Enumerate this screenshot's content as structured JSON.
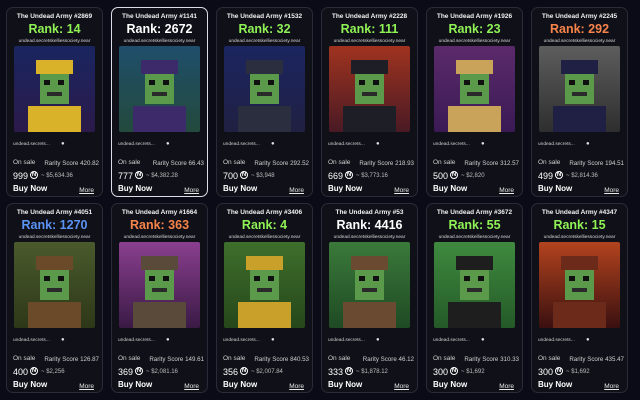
{
  "collection": "undead.secretskelliessociety.near",
  "owner_short": "undead.secrets...",
  "labels": {
    "on_sale": "On sale",
    "buy_now": "Buy Now",
    "more": "More",
    "near_symbol": "N"
  },
  "colors": {
    "green": "#8ff255",
    "white": "#ffffff",
    "orange": "#f7844a",
    "blue": "#5b93f5"
  },
  "cards": [
    {
      "title": "The Undead Army #2869",
      "rank": "Rank: 14",
      "rank_color": "green",
      "rarity": "Rarity Score 420.82",
      "price": "999",
      "usd": "~ $5,634.36",
      "bg": [
        "#1a2560",
        "#2b1a4a"
      ],
      "accent": "#d9b22a"
    },
    {
      "title": "The Undead Army #1141",
      "rank": "Rank: 2672",
      "rank_color": "white",
      "rarity": "Rarity Score 66.43",
      "price": "777",
      "usd": "~ $4,382.28",
      "bg": [
        "#1f4e6b",
        "#234a3c"
      ],
      "accent": "#3c2a6b"
    },
    {
      "title": "The Undead Army #1532",
      "rank": "Rank: 32",
      "rank_color": "green",
      "rarity": "Rarity Score 292.52",
      "price": "700",
      "usd": "~ $3,948",
      "bg": [
        "#1b2560",
        "#202042"
      ],
      "accent": "#2b2e3e"
    },
    {
      "title": "The Undead Army #2228",
      "rank": "Rank: 111",
      "rank_color": "green",
      "rarity": "Rarity Score 218.93",
      "price": "669",
      "usd": "~ $3,773.16",
      "bg": [
        "#a0331f",
        "#4a1a24"
      ],
      "accent": "#1e1e26"
    },
    {
      "title": "The Undead Army #1926",
      "rank": "Rank: 23",
      "rank_color": "green",
      "rarity": "Rarity Score 312.57",
      "price": "500",
      "usd": "~ $2,820",
      "bg": [
        "#5b2a6b",
        "#3a1a55"
      ],
      "accent": "#c9a35a"
    },
    {
      "title": "The Undead Army #2245",
      "rank": "Rank: 292",
      "rank_color": "orange",
      "rarity": "Rarity Score 194.51",
      "price": "499",
      "usd": "~ $2,814.36",
      "bg": [
        "#5d5d5d",
        "#2e2e2e"
      ],
      "accent": "#1f2044"
    },
    {
      "title": "The Undead Army #4051",
      "rank": "Rank: 1270",
      "rank_color": "blue",
      "rarity": "Rarity Score 126.87",
      "price": "400",
      "usd": "~ $2,256",
      "bg": [
        "#4a5a2c",
        "#2d3818"
      ],
      "accent": "#6b4a2a"
    },
    {
      "title": "The Undead Army #1664",
      "rank": "Rank: 363",
      "rank_color": "orange",
      "rarity": "Rarity Score 149.61",
      "price": "369",
      "usd": "~ $2,081.16",
      "bg": [
        "#8a3f8f",
        "#3a1a45"
      ],
      "accent": "#5a4a3a"
    },
    {
      "title": "The Undead Army #3406",
      "rank": "Rank: 4",
      "rank_color": "green",
      "rarity": "Rarity Score 840.53",
      "price": "356",
      "usd": "~ $2,007.84",
      "bg": [
        "#3e6f2c",
        "#26471a"
      ],
      "accent": "#c9a12a"
    },
    {
      "title": "The Undead Army #53",
      "rank": "Rank: 4416",
      "rank_color": "white",
      "rarity": "Rarity Score 46.12",
      "price": "333",
      "usd": "~ $1,878.12",
      "bg": [
        "#3a7a3a",
        "#1f4a24"
      ],
      "accent": "#6a4a30"
    },
    {
      "title": "The Undead Army #3672",
      "rank": "Rank: 55",
      "rank_color": "green",
      "rarity": "Rarity Score 310.33",
      "price": "300",
      "usd": "~ $1,692",
      "bg": [
        "#3f8a3f",
        "#245a28"
      ],
      "accent": "#1e1e1e"
    },
    {
      "title": "The Undead Army #4347",
      "rank": "Rank: 15",
      "rank_color": "green",
      "rarity": "Rarity Score 435.47",
      "price": "300",
      "usd": "~ $1,692",
      "bg": [
        "#b3431e",
        "#3a1010"
      ],
      "accent": "#6b2a1a"
    }
  ]
}
